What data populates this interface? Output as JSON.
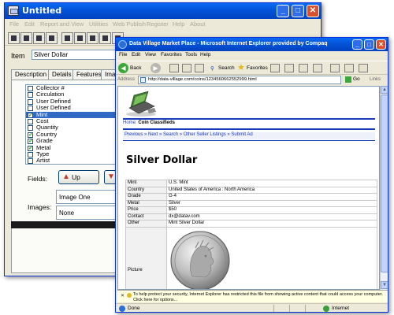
{
  "window_a": {
    "title": "Untitled",
    "menu": [
      "File",
      "Edit",
      "Report and View",
      "Utilities",
      "Web Publish",
      "Register",
      "Help",
      "About"
    ],
    "item_label": "Item",
    "item_value": "Silver Dollar",
    "tabs": [
      "Description",
      "Details",
      "Features",
      "Images"
    ],
    "fields": [
      {
        "label": "Collector #",
        "checked": false
      },
      {
        "label": "Circulation",
        "checked": false
      },
      {
        "label": "User Defined",
        "checked": false
      },
      {
        "label": "User Defined",
        "checked": false
      },
      {
        "label": "Mint",
        "checked": true,
        "selected": true
      },
      {
        "label": "Cost",
        "checked": false
      },
      {
        "label": "Quantity",
        "checked": false
      },
      {
        "label": "Country",
        "checked": true
      },
      {
        "label": "Grade",
        "checked": true
      },
      {
        "label": "Metal",
        "checked": true
      },
      {
        "label": "Type",
        "checked": false
      },
      {
        "label": "Artist",
        "checked": false
      }
    ],
    "fields_label": "Fields:",
    "up_label": "Up",
    "images_label": "Images:",
    "image_value": "Image One",
    "image2_value": "None"
  },
  "window_b": {
    "title": "Data Village Market Place - Microsoft Internet Explorer provided by Compaq",
    "menu": [
      "File",
      "Edit",
      "View",
      "Favorites",
      "Tools",
      "Help"
    ],
    "back_label": "Back",
    "search_label": "Search",
    "favorites_label": "Favorites",
    "address_label": "Address",
    "address_value": "http://data-village.com/coins/1234560662552999.html",
    "go_label": "Go",
    "links_label": "Links",
    "nav_home": "Home:",
    "nav_section": "Coin Classifieds",
    "crumbs": "Previous » Next » Search » Other Seller Listings » Submit Ad",
    "page_title": "Silver Dollar",
    "details": [
      {
        "key": "Mint",
        "value": "U.S. Mint"
      },
      {
        "key": "Country",
        "value": "United States of America : North America"
      },
      {
        "key": "Grade",
        "value": "G-4"
      },
      {
        "key": "Metal",
        "value": "Silver"
      },
      {
        "key": "Price",
        "value": "$50"
      },
      {
        "key": "Contact",
        "value": "dx@datav.com"
      },
      {
        "key": "Other",
        "value": "Mint Silver Dollar"
      }
    ],
    "picture_label": "Picture",
    "infobar_text": "To help protect your security, Internet Explorer has restricted this file from showing active content that could access your computer. Click here for options...",
    "status_text": "Done",
    "zone_text": "Internet"
  }
}
